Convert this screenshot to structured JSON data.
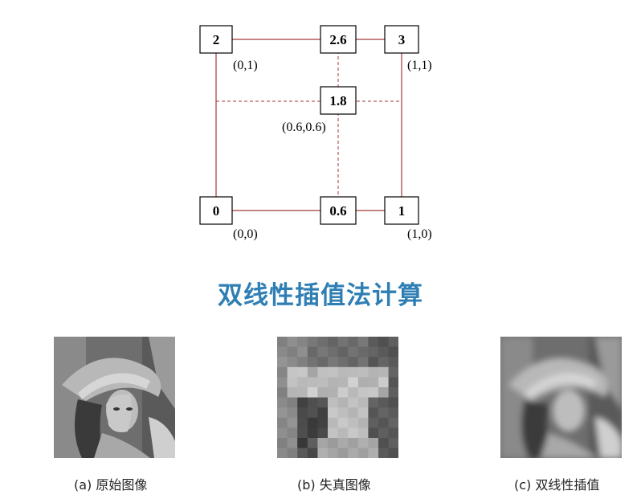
{
  "diagram": {
    "nodes": {
      "top_left": "2",
      "top_mid": "2.6",
      "top_right": "3",
      "center": "1.8",
      "bottom_left": "0",
      "bottom_mid": "0.6",
      "bottom_right": "1"
    },
    "coords": {
      "top_left": "(0,1)",
      "top_right": "(1,1)",
      "center": "(0.6,0.6)",
      "bottom_left": "(0,0)",
      "bottom_right": "(1,0)"
    },
    "line_color": "#a33a3a"
  },
  "heading": "双线性插值法计算",
  "heading_color": "#2f7fb5",
  "figures": [
    {
      "caption": "(a)  原始图像",
      "style": "sharp"
    },
    {
      "caption": "(b)  失真图像",
      "style": "pixelated"
    },
    {
      "caption": "(c)  双线性插值",
      "style": "blurred"
    }
  ]
}
